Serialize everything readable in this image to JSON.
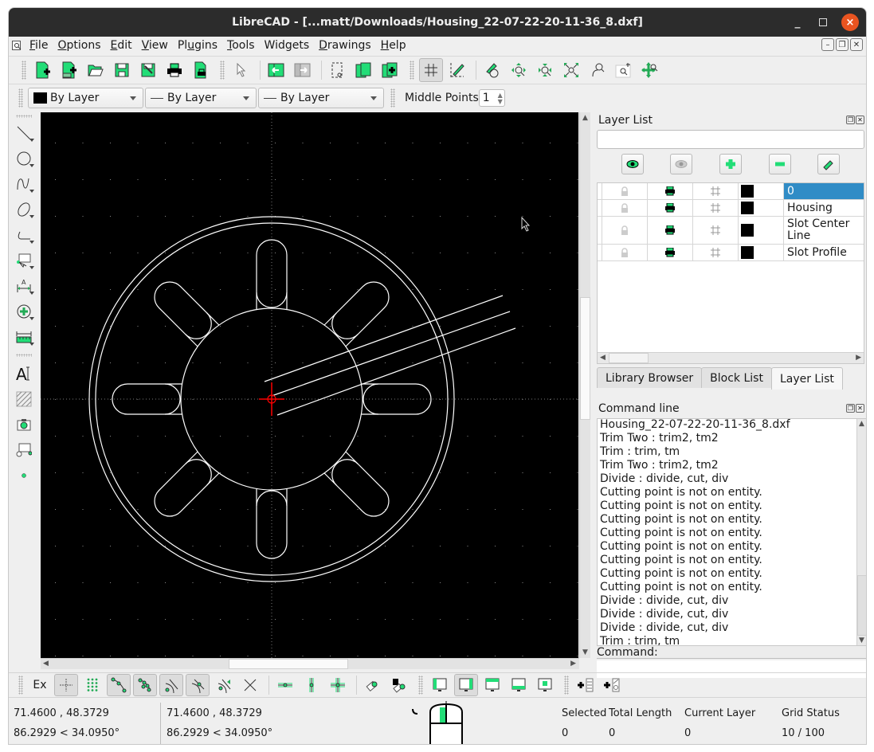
{
  "window": {
    "title": "LibreCAD - [...matt/Downloads/Housing_22-07-22-20-11-36_8.dxf]",
    "controls": {
      "minimize": "_",
      "close": "×"
    }
  },
  "menu": {
    "items": [
      {
        "label": "File",
        "accel": "F"
      },
      {
        "label": "Options",
        "accel": "O"
      },
      {
        "label": "Edit",
        "accel": "E"
      },
      {
        "label": "View",
        "accel": "V"
      },
      {
        "label": "Plugins",
        "accel": "u"
      },
      {
        "label": "Tools",
        "accel": "T"
      },
      {
        "label": "Widgets",
        "accel": ""
      },
      {
        "label": "Drawings",
        "accel": "D"
      },
      {
        "label": "Help",
        "accel": "H"
      }
    ]
  },
  "toolbar": {
    "icons": [
      "new-file-icon",
      "new-from-template-icon",
      "open-folder-icon",
      "save-icon",
      "save-as-icon",
      "print-icon",
      "print-preview-icon",
      "select-pointer-icon",
      "block-to-front-icon",
      "block-to-back-icon",
      "cut-selection-icon",
      "copy-pages-icon",
      "paste-icon",
      "grid-icon",
      "draft-mode-icon",
      "redraw-icon",
      "zoom-in-icon",
      "zoom-out-icon",
      "zoom-auto-icon",
      "zoom-previous-icon",
      "zoom-window-icon",
      "zoom-pan-icon"
    ]
  },
  "pen_toolbar": {
    "color": "By Layer",
    "width": "By Layer",
    "linetype": "By Layer",
    "middle_points_label": "Middle Points",
    "middle_points_value": "1"
  },
  "layer_list": {
    "title": "Layer List",
    "filter_placeholder": "",
    "buttons": [
      "show-all-layers",
      "hide-all-layers",
      "add-layer",
      "remove-layer",
      "edit-layer"
    ],
    "layers": [
      {
        "name": "0",
        "selected": true,
        "color": "#000000"
      },
      {
        "name": "Housing",
        "selected": false,
        "color": "#000000"
      },
      {
        "name": "Slot Center Line",
        "selected": false,
        "color": "#000000"
      },
      {
        "name": "Slot Profile",
        "selected": false,
        "color": "#000000"
      }
    ]
  },
  "dock_tabs": [
    {
      "label": "Library Browser",
      "active": false
    },
    {
      "label": "Block List",
      "active": false
    },
    {
      "label": "Layer List",
      "active": true
    }
  ],
  "command_line": {
    "title": "Command line",
    "lines": [
      "Housing_22-07-22-20-11-36_8.dxf",
      "Trim Two : trim2, tm2",
      "Trim : trim, tm",
      "Trim Two : trim2, tm2",
      "Divide : divide, cut, div",
      "Cutting point is not on entity.",
      "Cutting point is not on entity.",
      "Cutting point is not on entity.",
      "Cutting point is not on entity.",
      "Cutting point is not on entity.",
      "Cutting point is not on entity.",
      "Cutting point is not on entity.",
      "Cutting point is not on entity.",
      "Divide : divide, cut, div",
      "Divide : divide, cut, div",
      "Divide : divide, cut, div",
      "Trim : trim, tm"
    ],
    "prompt": "Command:",
    "input_value": ""
  },
  "snap_toolbar": {
    "ex_label": "Ex",
    "icons": [
      "snap-free-icon",
      "snap-grid-icon",
      "snap-endpoint-icon",
      "snap-entity-icon",
      "snap-center-icon",
      "snap-middle-icon",
      "snap-distance-icon",
      "snap-intersection-icon",
      "restrict-horizontal-icon",
      "restrict-vertical-icon",
      "restrict-orthogonal-icon",
      "relative-zero-icon",
      "lock-relative-zero-icon",
      "viewport-left-icon",
      "viewport-full-icon",
      "viewport-top-icon",
      "viewport-bottom-icon",
      "viewport-center-icon",
      "add-line-icon",
      "add-text-icon"
    ]
  },
  "status": {
    "abs_coord": "71.4600 , 48.3729",
    "abs_polar": "86.2929 < 34.0950°",
    "rel_coord": "71.4600 , 48.3729",
    "rel_polar": "86.2929 < 34.0950°",
    "selected_label": "Selected",
    "selected_value": "0",
    "total_length_label": "Total Length",
    "total_length_value": "0",
    "current_layer_label": "Current Layer",
    "current_layer_value": "0",
    "grid_status_label": "Grid Status",
    "grid_status_value": "10 / 100"
  },
  "colors": {
    "accent_green": "#22dd77",
    "selection_blue": "#308cc6",
    "canvas_bg": "#000000",
    "entity_white": "#ffffff",
    "origin_red": "#ff0000",
    "close_button": "#e95420"
  }
}
